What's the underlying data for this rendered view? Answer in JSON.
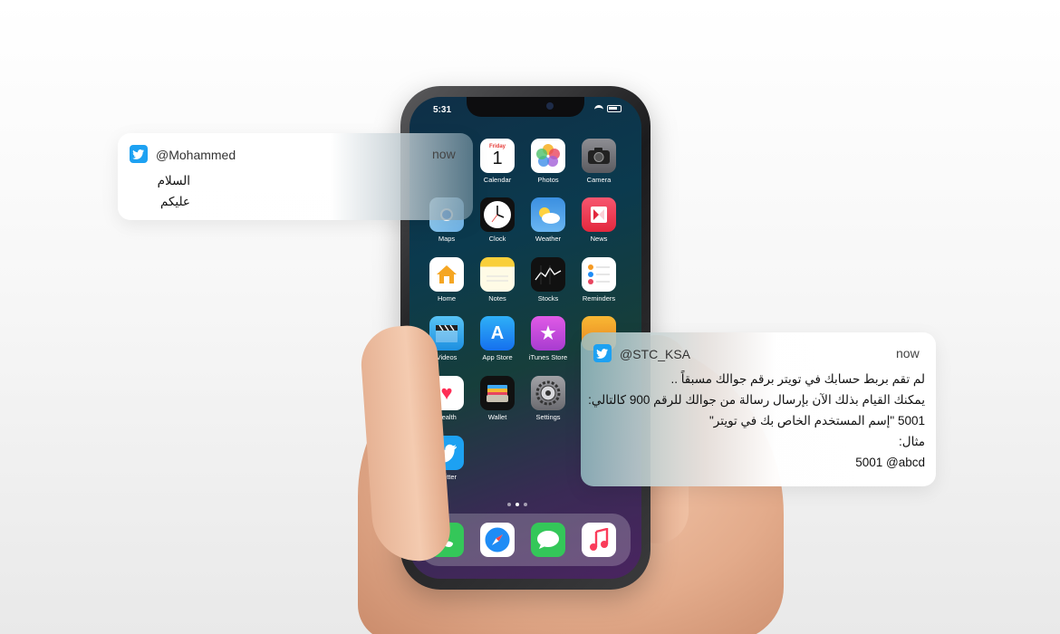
{
  "notifications": [
    {
      "handle": "@Mohammed",
      "time": "now",
      "message": "السلام عليكم"
    },
    {
      "handle": "@STC_KSA",
      "time": "now",
      "lines": [
        "لم تقم بربط حسابك في تويتر برقم جوالك مسبقاً ..",
        "يمكنك القيام بذلك الآن بإرسال رسالة من جوالك للرقم 900 كالتالي:",
        "5001 \"إسم المستخدم الخاص بك في تويتر\"",
        "مثال:",
        "5001 @abcd"
      ]
    }
  ],
  "phone": {
    "status_time": "5:31",
    "calendar_day": "Friday",
    "calendar_date": "1",
    "apps": [
      {
        "label": "Calendar",
        "color": "#ffffff"
      },
      {
        "label": "Photos",
        "color": "#ffffff"
      },
      {
        "label": "Camera",
        "color": "#6e6e73"
      },
      {
        "label": "Maps",
        "color": "#7fc4f0"
      },
      {
        "label": "Clock",
        "color": "#111111"
      },
      {
        "label": "Weather",
        "color": "#4a9ee8"
      },
      {
        "label": "News",
        "color": "#f5405b"
      },
      {
        "label": "Home",
        "color": "#ffffff"
      },
      {
        "label": "Notes",
        "color": "#fffbe6"
      },
      {
        "label": "Stocks",
        "color": "#111111"
      },
      {
        "label": "Reminders",
        "color": "#ffffff"
      },
      {
        "label": "Videos",
        "color": "#2b9ef0"
      },
      {
        "label": "App Store",
        "color": "#1e8cf5"
      },
      {
        "label": "iTunes Store",
        "color": "#c545d8"
      },
      {
        "label": "Health",
        "color": "#ffffff"
      },
      {
        "label": "Wallet",
        "color": "#111111"
      },
      {
        "label": "Settings",
        "color": "#8e8e93"
      },
      {
        "label": "Twitter",
        "color": "#1da1f2"
      }
    ],
    "dock": [
      {
        "name": "phone-icon",
        "color": "#34c759"
      },
      {
        "name": "safari-icon",
        "color": "#ffffff"
      },
      {
        "name": "messages-icon",
        "color": "#34c759"
      },
      {
        "name": "music-icon",
        "color": "#ffffff"
      }
    ]
  }
}
